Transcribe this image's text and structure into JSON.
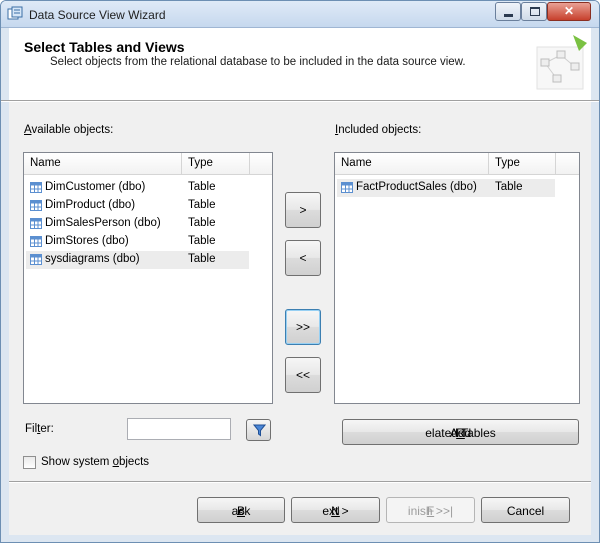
{
  "window": {
    "title": "Data Source View Wizard",
    "controls": {
      "minimize": "minimize-icon",
      "maximize": "maximize-icon",
      "close": "close-icon"
    }
  },
  "header": {
    "title": "Select Tables and Views",
    "subtitle": "Select objects from the relational database to be included in the data source view."
  },
  "available": {
    "label_accel": "A",
    "label_rest": "vailable objects:",
    "columns": {
      "name": "Name",
      "type": "Type"
    },
    "rows": [
      {
        "name": "DimCustomer (dbo)",
        "type": "Table",
        "selected": false
      },
      {
        "name": "DimProduct (dbo)",
        "type": "Table",
        "selected": false
      },
      {
        "name": "DimSalesPerson (dbo)",
        "type": "Table",
        "selected": false
      },
      {
        "name": "DimStores (dbo)",
        "type": "Table",
        "selected": false
      },
      {
        "name": "sysdiagrams (dbo)",
        "type": "Table",
        "selected": true
      }
    ]
  },
  "included": {
    "label_accel": "I",
    "label_rest": "ncluded objects:",
    "columns": {
      "name": "Name",
      "type": "Type"
    },
    "rows": [
      {
        "name": "FactProductSales (dbo)",
        "type": "Table",
        "selected": true
      }
    ]
  },
  "move_buttons": {
    "add": ">",
    "remove": "<",
    "add_all": ">>",
    "remove_all": "<<"
  },
  "filter": {
    "label_pre": "Fil",
    "label_accel": "t",
    "label_post": "er:",
    "value": "",
    "button_icon": "filter-funnel-icon"
  },
  "show_system": {
    "label_pre": "Show system ",
    "label_accel": "o",
    "label_post": "bjects",
    "checked": false
  },
  "add_related": {
    "label_pre": "Add ",
    "label_accel": "R",
    "label_post": "elated Tables"
  },
  "footer": {
    "back_pre": "< ",
    "back_accel": "B",
    "back_post": "ack",
    "next_accel": "N",
    "next_post": "ext >",
    "finish_accel": "F",
    "finish_post": "inish >>|",
    "cancel": "Cancel"
  },
  "colors": {
    "table_icon": "#5b8fd0",
    "selected_row": "#ececec",
    "titlebar_top": "#dfeaf7",
    "close_button": "#c7402c"
  }
}
